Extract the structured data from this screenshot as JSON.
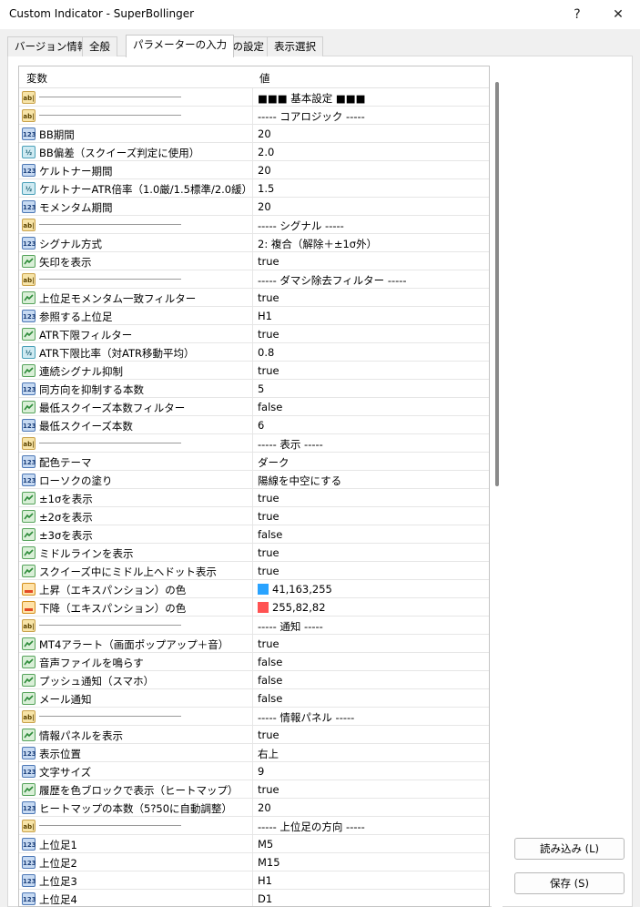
{
  "window": {
    "title": "Custom Indicator - SuperBollinger",
    "help_label": "?",
    "close_label": "✕"
  },
  "tabs": [
    {
      "label": "バージョン情報",
      "active": false
    },
    {
      "label": "全般",
      "active": false
    },
    {
      "label": "パラメーターの入力",
      "active": true
    },
    {
      "label": "色の設定",
      "active": false
    },
    {
      "label": "表示選択",
      "active": false
    }
  ],
  "grid": {
    "col_variable": "変数",
    "col_value": "値",
    "rows": [
      {
        "type": "ab",
        "name": "",
        "value": "■■■ 基本設定 ■■■",
        "separator": true
      },
      {
        "type": "ab",
        "name": "",
        "value": "----- コアロジック -----",
        "separator": true
      },
      {
        "type": "int",
        "name": "BB期間",
        "value": "20"
      },
      {
        "type": "dbl",
        "name": "BB偏差（スクイーズ判定に使用）",
        "value": "2.0"
      },
      {
        "type": "int",
        "name": "ケルトナー期間",
        "value": "20"
      },
      {
        "type": "dbl",
        "name": "ケルトナーATR倍率（1.0厳/1.5標準/2.0緩）",
        "value": "1.5"
      },
      {
        "type": "int",
        "name": "モメンタム期間",
        "value": "20"
      },
      {
        "type": "ab",
        "name": "",
        "value": "----- シグナル -----",
        "separator": true
      },
      {
        "type": "int",
        "name": "シグナル方式",
        "value": "2: 複合（解除＋±1σ外）"
      },
      {
        "type": "bool",
        "name": "矢印を表示",
        "value": "true"
      },
      {
        "type": "ab",
        "name": "",
        "value": "----- ダマシ除去フィルター -----",
        "separator": true
      },
      {
        "type": "bool",
        "name": "上位足モメンタム一致フィルター",
        "value": "true"
      },
      {
        "type": "int",
        "name": "参照する上位足",
        "value": "H1"
      },
      {
        "type": "bool",
        "name": "ATR下限フィルター",
        "value": "true"
      },
      {
        "type": "dbl",
        "name": "ATR下限比率（対ATR移動平均）",
        "value": "0.8"
      },
      {
        "type": "bool",
        "name": "連続シグナル抑制",
        "value": "true"
      },
      {
        "type": "int",
        "name": "同方向を抑制する本数",
        "value": "5"
      },
      {
        "type": "bool",
        "name": "最低スクイーズ本数フィルター",
        "value": "false"
      },
      {
        "type": "int",
        "name": "最低スクイーズ本数",
        "value": "6"
      },
      {
        "type": "ab",
        "name": "",
        "value": "----- 表示 -----",
        "separator": true
      },
      {
        "type": "int",
        "name": "配色テーマ",
        "value": "ダーク"
      },
      {
        "type": "int",
        "name": "ローソクの塗り",
        "value": "陽線を中空にする"
      },
      {
        "type": "bool",
        "name": "±1σを表示",
        "value": "true"
      },
      {
        "type": "bool",
        "name": "±2σを表示",
        "value": "true"
      },
      {
        "type": "bool",
        "name": "±3σを表示",
        "value": "false"
      },
      {
        "type": "bool",
        "name": "ミドルラインを表示",
        "value": "true"
      },
      {
        "type": "bool",
        "name": "スクイーズ中にミドル上へドット表示",
        "value": "true"
      },
      {
        "type": "clr",
        "name": "上昇（エキスパンション）の色",
        "value": "41,163,255",
        "swatch": "#29a3ff"
      },
      {
        "type": "clr",
        "name": "下降（エキスパンション）の色",
        "value": "255,82,82",
        "swatch": "#ff5252"
      },
      {
        "type": "ab",
        "name": "",
        "value": "----- 通知 -----",
        "separator": true
      },
      {
        "type": "bool",
        "name": "MT4アラート（画面ポップアップ＋音）",
        "value": "true"
      },
      {
        "type": "bool",
        "name": "音声ファイルを鳴らす",
        "value": "false"
      },
      {
        "type": "bool",
        "name": "プッシュ通知（スマホ）",
        "value": "false"
      },
      {
        "type": "bool",
        "name": "メール通知",
        "value": "false"
      },
      {
        "type": "ab",
        "name": "",
        "value": "----- 情報パネル -----",
        "separator": true
      },
      {
        "type": "bool",
        "name": "情報パネルを表示",
        "value": "true"
      },
      {
        "type": "int",
        "name": "表示位置",
        "value": "右上"
      },
      {
        "type": "int",
        "name": "文字サイズ",
        "value": "9"
      },
      {
        "type": "bool",
        "name": "履歴を色ブロックで表示（ヒートマップ）",
        "value": "true"
      },
      {
        "type": "int",
        "name": "ヒートマップの本数（5?50に自動調整）",
        "value": "20"
      },
      {
        "type": "ab",
        "name": "",
        "value": "----- 上位足の方向 -----",
        "separator": true
      },
      {
        "type": "int",
        "name": "上位足1",
        "value": "M5"
      },
      {
        "type": "int",
        "name": "上位足2",
        "value": "M15"
      },
      {
        "type": "int",
        "name": "上位足3",
        "value": "H1"
      },
      {
        "type": "int",
        "name": "上位足4",
        "value": "D1"
      }
    ]
  },
  "icon_labels": {
    "ab": "ab|",
    "int": "123",
    "dbl": "½"
  },
  "buttons": {
    "load_label": "読み込み (L)",
    "save_label": "保存 (S)"
  }
}
